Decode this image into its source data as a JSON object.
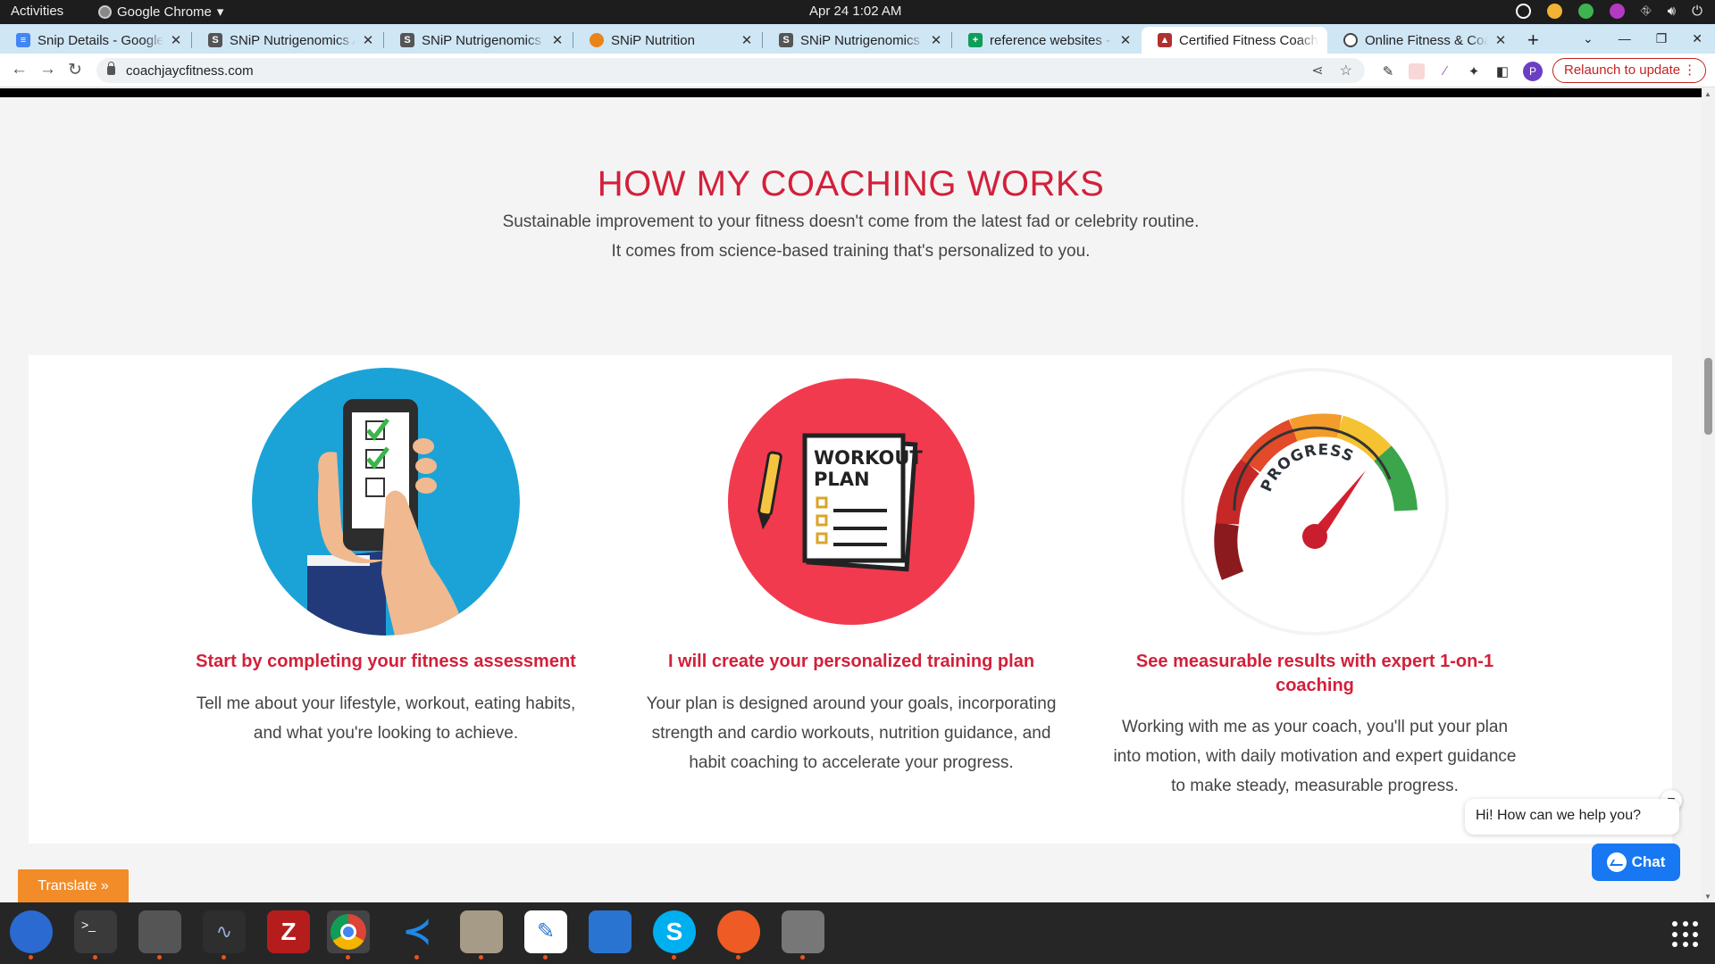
{
  "system_bar": {
    "activities": "Activities",
    "app_name": "Google Chrome",
    "clock": "Apr 24  1:02 AM"
  },
  "tabs": [
    {
      "title": "Snip Details - Google Docs",
      "favicon": "docs-icon",
      "color": "#4285f4"
    },
    {
      "title": "SNiP Nutrigenomics Admin",
      "favicon": "snip-logo-icon",
      "color": "#555555"
    },
    {
      "title": "SNiP Nutrigenomics Admin",
      "favicon": "snip-logo-icon",
      "color": "#555555"
    },
    {
      "title": "SNiP Nutrition",
      "favicon": "snip-nutrition-icon",
      "color": "#e8841a"
    },
    {
      "title": "SNiP Nutrigenomics Admin",
      "favicon": "snip-logo-icon",
      "color": "#555555"
    },
    {
      "title": "reference websites - Google Sheets",
      "favicon": "sheets-icon",
      "color": "#0f9d58"
    },
    {
      "title": "Certified Fitness Coach",
      "favicon": "coach-icon",
      "color": "#b03030",
      "active": true
    },
    {
      "title": "Online Fitness & Coaching",
      "favicon": "globe-icon",
      "color": "#444444"
    }
  ],
  "toolbar": {
    "url": "coachjaycfitness.com",
    "relaunch_label": "Relaunch to update",
    "profile_initial": "P"
  },
  "page": {
    "headline": "HOW MY COACHING WORKS",
    "subtitle": "Sustainable improvement to your fitness doesn't come from the latest fad or celebrity routine. It comes from science-based training that's personalized to you.",
    "steps": [
      {
        "title": "Start by completing your fitness assessment",
        "body": "Tell me about your lifestyle, workout, eating habits, and what you're looking to achieve.",
        "icon": "phone-checklist-icon"
      },
      {
        "title": "I will create your personalized training plan",
        "body": "Your plan is designed around your goals, incorporating strength and cardio workouts, nutrition guidance, and habit coaching to accelerate your progress.",
        "icon": "workout-plan-icon",
        "icon_text_1": "WORKOUT",
        "icon_text_2": "PLAN"
      },
      {
        "title": "See measurable results with expert 1-on-1 coaching",
        "body": "Working with me as your coach, you'll put your plan into motion, with daily motivation and expert guidance to make steady, measurable progress.",
        "icon": "progress-gauge-icon",
        "icon_text": "PROGRESS"
      }
    ],
    "chat_greeting": "Hi! How can we help you?",
    "chat_button": "Chat",
    "translate_button": "Translate »"
  },
  "colors": {
    "accent": "#d3203a",
    "chat_blue": "#1877f2",
    "translate_orange": "#f28c28"
  },
  "dock": [
    {
      "name": "thunderbird-icon",
      "color": "#2a6ad1"
    },
    {
      "name": "terminal-icon",
      "color": "#3a3a3a"
    },
    {
      "name": "calculator-icon",
      "color": "#555555"
    },
    {
      "name": "system-monitor-icon",
      "color": "#2e2e2e"
    },
    {
      "name": "filezilla-icon",
      "color": "#b51d1d"
    },
    {
      "name": "chrome-icon",
      "color": "#ffffff"
    },
    {
      "name": "vscode-icon",
      "color": "#1e88e5"
    },
    {
      "name": "files-icon",
      "color": "#a59b86"
    },
    {
      "name": "text-editor-icon",
      "color": "#ffffff"
    },
    {
      "name": "writer-icon",
      "color": "#2a74d1"
    },
    {
      "name": "skype-icon",
      "color": "#00aff0"
    },
    {
      "name": "postman-icon",
      "color": "#ef5b25"
    },
    {
      "name": "disk-icon",
      "color": "#777777"
    }
  ]
}
